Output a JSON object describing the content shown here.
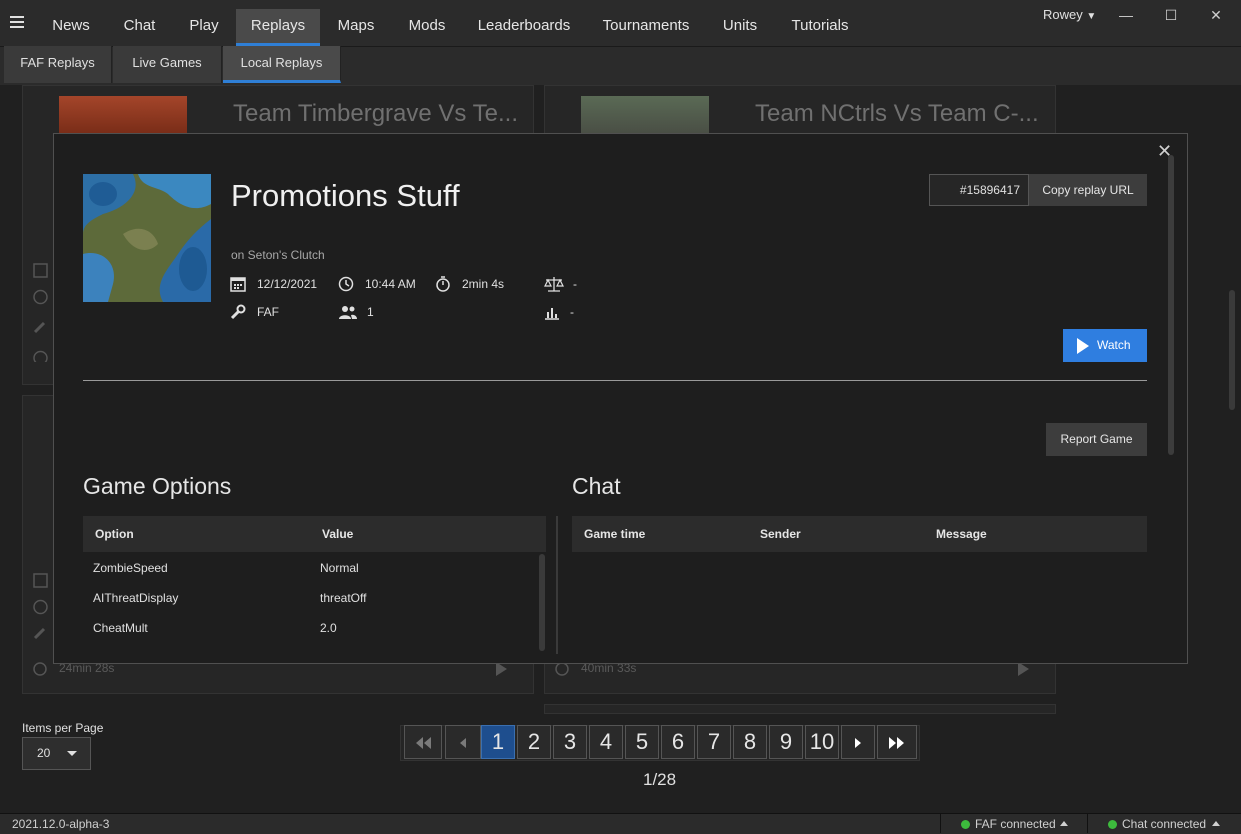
{
  "nav": {
    "tabs": [
      {
        "label": "News"
      },
      {
        "label": "Chat"
      },
      {
        "label": "Play"
      },
      {
        "label": "Replays"
      },
      {
        "label": "Maps"
      },
      {
        "label": "Mods"
      },
      {
        "label": "Leaderboards"
      },
      {
        "label": "Tournaments"
      },
      {
        "label": "Units"
      },
      {
        "label": "Tutorials"
      }
    ],
    "active_tab": "Replays",
    "user": "Rowey",
    "window_controls": {
      "minimize": "—",
      "maximize": "☐",
      "close": "✕"
    }
  },
  "subnav": {
    "tabs": [
      {
        "label": "FAF Replays"
      },
      {
        "label": "Live Games"
      },
      {
        "label": "Local Replays"
      }
    ],
    "active_tab": "Local Replays"
  },
  "background_cards": [
    {
      "title": "Team Timbergrave Vs Te...",
      "duration": "24min 28s"
    },
    {
      "title": "Team NCtrls Vs Team C-...",
      "duration": "40min 33s"
    }
  ],
  "replay": {
    "title": "Promotions Stuff",
    "map": "on Seton's Clutch",
    "date": "12/12/2021",
    "time": "10:44 AM",
    "duration": "2min 4s",
    "balance": "-",
    "featured_mod": "FAF",
    "players": "1",
    "rating": "-",
    "id": "#15896417",
    "copy_url_label": "Copy replay URL",
    "watch_label": "Watch",
    "report_label": "Report Game",
    "close_icon": "close-icon"
  },
  "game_options": {
    "title": "Game Options",
    "headers": {
      "option": "Option",
      "value": "Value"
    },
    "rows": [
      {
        "option": "ZombieSpeed",
        "value": "Normal"
      },
      {
        "option": "AIThreatDisplay",
        "value": "threatOff"
      },
      {
        "option": "CheatMult",
        "value": "2.0"
      }
    ]
  },
  "chat": {
    "title": "Chat",
    "headers": {
      "time": "Game time",
      "sender": "Sender",
      "message": "Message"
    }
  },
  "pagination": {
    "pages": [
      "1",
      "2",
      "3",
      "4",
      "5",
      "6",
      "7",
      "8",
      "9",
      "10"
    ],
    "current": "1",
    "info": "1/28",
    "items_per_page_label": "Items per Page",
    "items_per_page": "20"
  },
  "status": {
    "version": "2021.12.0-alpha-3",
    "faf": "FAF connected",
    "chat": "Chat connected",
    "color_connected": "#3dbb3d"
  },
  "colors": {
    "accent": "#2f7ee0",
    "background": "#202020"
  }
}
